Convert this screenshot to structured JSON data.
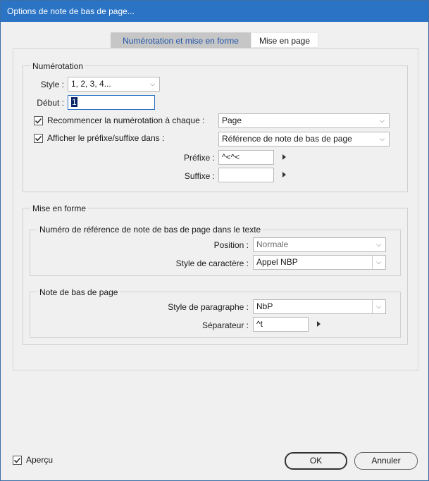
{
  "window": {
    "title": "Options de note de bas de page..."
  },
  "tabs": [
    {
      "label": "Numérotation et mise en forme",
      "active": true
    },
    {
      "label": "Mise en page",
      "active": false
    }
  ],
  "numerotation": {
    "legend": "Numérotation",
    "style_label": "Style :",
    "style_value": "1, 2, 3, 4...",
    "debut_label": "Début :",
    "debut_value": "1",
    "restart_checked": true,
    "restart_label": "Recommencer la numérotation à chaque :",
    "restart_value": "Page",
    "prefix_checked": true,
    "prefix_label": "Afficher le préfixe/suffixe dans :",
    "prefix_value": "Référence de note de bas de page",
    "prefixe_label": "Préfixe :",
    "prefixe_value": "^<^<",
    "suffixe_label": "Suffixe :",
    "suffixe_value": ""
  },
  "mise_en_forme": {
    "legend": "Mise en forme",
    "ref_group": {
      "legend": "Numéro de référence de note de bas de page dans le texte",
      "position_label": "Position :",
      "position_value": "Normale",
      "char_style_label": "Style de caractère :",
      "char_style_value": "Appel NBP"
    },
    "note_group": {
      "legend": "Note de bas de page",
      "para_style_label": "Style de paragraphe :",
      "para_style_value": "NbP",
      "separateur_label": "Séparateur :",
      "separateur_value": "^t"
    }
  },
  "footer": {
    "apercu_checked": true,
    "apercu_label": "Aperçu",
    "ok_label": "OK",
    "cancel_label": "Annuler"
  }
}
